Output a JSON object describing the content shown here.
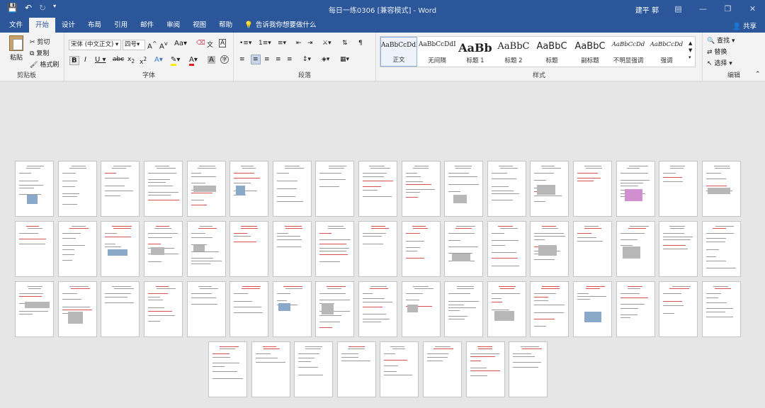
{
  "window": {
    "title": "每日一练0306 [兼容模式] - Word",
    "user": "建平 郭"
  },
  "tabs": [
    "文件",
    "开始",
    "设计",
    "布局",
    "引用",
    "邮件",
    "审阅",
    "视图",
    "帮助"
  ],
  "active_tab": "开始",
  "tell_me": "告诉我你想要做什么",
  "share": "共享",
  "clipboard": {
    "paste": "粘贴",
    "cut": "剪切",
    "copy": "复制",
    "format_painter": "格式刷",
    "label": "剪贴板"
  },
  "font": {
    "name": "宋体 (中文正文)",
    "size": "四号",
    "label": "字体"
  },
  "paragraph": {
    "label": "段落"
  },
  "styles": {
    "label": "样式",
    "items": [
      {
        "preview": "AaBbCcDdI",
        "name": "正文"
      },
      {
        "preview": "AaBbCcDdI",
        "name": "无间隔"
      },
      {
        "preview": "AaBb",
        "name": "标题 1"
      },
      {
        "preview": "AaBbC",
        "name": "标题 2"
      },
      {
        "preview": "AaBbC",
        "name": "标题"
      },
      {
        "preview": "AaBbC",
        "name": "副标题"
      },
      {
        "preview": "AaBbCcDd",
        "name": "不明显强调"
      },
      {
        "preview": "AaBbCcDd",
        "name": "强调"
      }
    ]
  },
  "editing": {
    "find": "查找",
    "replace": "替换",
    "select": "选择",
    "label": "编辑"
  },
  "document": {
    "page_rows": [
      17,
      17,
      17,
      8
    ],
    "total_pages": 59
  }
}
